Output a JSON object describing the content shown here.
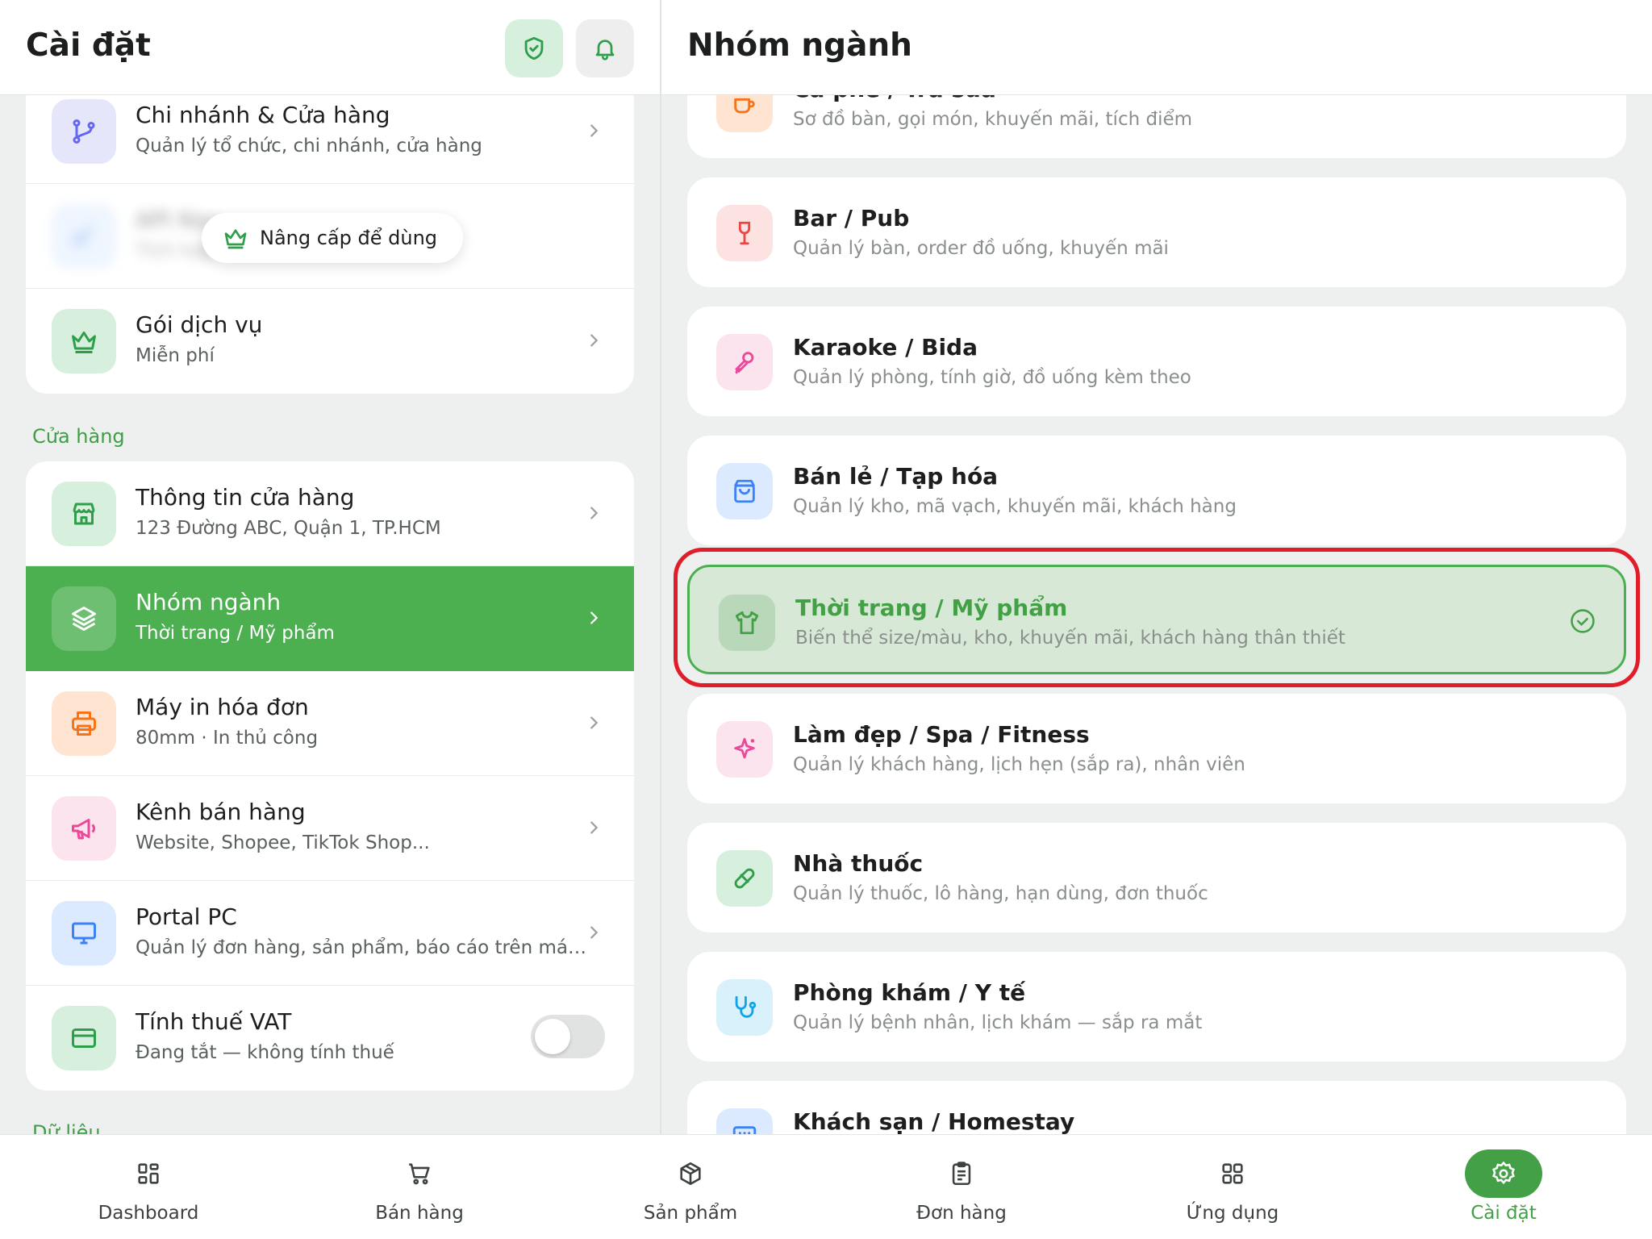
{
  "colors": {
    "brand": "#4caf50",
    "brand_dark": "#43a047",
    "highlight": "#e11d2a"
  },
  "left": {
    "title": "Cài đặt",
    "header_icons": [
      "shield-check-icon",
      "bell-icon"
    ],
    "top_card": [
      {
        "title": "Chi nhánh & Cửa hàng",
        "subtitle": "Quản lý tổ chức, chi nhánh, cửa hàng",
        "icon": "branch-icon"
      },
      {
        "title": "API Key",
        "subtitle": "Tích hợp",
        "icon": "key-icon",
        "locked": true
      },
      {
        "title": "Gói dịch vụ",
        "subtitle": "Miễn phí",
        "icon": "crown-icon"
      }
    ],
    "upgrade_label": "Nâng cấp để dùng",
    "store_section_label": "Cửa hàng",
    "store_card": [
      {
        "title": "Thông tin cửa hàng",
        "subtitle": "123 Đường ABC, Quận 1, TP.HCM",
        "icon": "store-icon"
      },
      {
        "title": "Nhóm ngành",
        "subtitle": "Thời trang / Mỹ phẩm",
        "icon": "layers-icon",
        "active": true
      },
      {
        "title": "Máy in hóa đơn",
        "subtitle": "80mm · In thủ công",
        "icon": "printer-icon"
      },
      {
        "title": "Kênh bán hàng",
        "subtitle": "Website, Shopee, TikTok Shop...",
        "icon": "megaphone-icon"
      },
      {
        "title": "Portal PC",
        "subtitle": "Quản lý đơn hàng, sản phẩm, báo cáo trên máy ...",
        "icon": "monitor-icon"
      },
      {
        "title": "Tính thuế VAT",
        "subtitle": "Đang tắt — không tính thuế",
        "icon": "card-icon",
        "toggle_on": false
      }
    ],
    "data_section_label": "Dữ liệu"
  },
  "right": {
    "title": "Nhóm ngành",
    "industries": [
      {
        "title": "Cà phê / Trà sữa",
        "subtitle": "Sơ đồ bàn, gọi món, khuyến mãi, tích điểm",
        "icon": "coffee-cup-icon"
      },
      {
        "title": "Bar / Pub",
        "subtitle": "Quản lý bàn, order đồ uống, khuyến mãi",
        "icon": "wine-glass-icon"
      },
      {
        "title": "Karaoke / Bida",
        "subtitle": "Quản lý phòng, tính giờ, đồ uống kèm theo",
        "icon": "microphone-icon"
      },
      {
        "title": "Bán lẻ / Tạp hóa",
        "subtitle": "Quản lý kho, mã vạch, khuyến mãi, khách hàng",
        "icon": "shopping-bag-icon"
      },
      {
        "title": "Thời trang / Mỹ phẩm",
        "subtitle": "Biến thể size/màu, kho, khuyến mãi, khách hàng thân thiết",
        "icon": "shirt-icon",
        "selected": true
      },
      {
        "title": "Làm đẹp / Spa / Fitness",
        "subtitle": "Quản lý khách hàng, lịch hẹn (sắp ra), nhân viên",
        "icon": "sparkles-icon"
      },
      {
        "title": "Nhà thuốc",
        "subtitle": "Quản lý thuốc, lô hàng, hạn dùng, đơn thuốc",
        "icon": "pill-icon"
      },
      {
        "title": "Phòng khám / Y tế",
        "subtitle": "Quản lý bệnh nhân, lịch khám — sắp ra mắt",
        "icon": "stethoscope-icon"
      },
      {
        "title": "Khách sạn / Homestay",
        "subtitle": "",
        "icon": "calendar-grid-icon"
      }
    ]
  },
  "nav": {
    "items": [
      {
        "label": "Dashboard",
        "icon": "grid-icon"
      },
      {
        "label": "Bán hàng",
        "icon": "cart-icon"
      },
      {
        "label": "Sản phẩm",
        "icon": "box-icon"
      },
      {
        "label": "Đơn hàng",
        "icon": "clipboard-icon"
      },
      {
        "label": "Ứng dụng",
        "icon": "apps-icon"
      },
      {
        "label": "Cài đặt",
        "icon": "gear-icon",
        "active": true
      }
    ]
  }
}
